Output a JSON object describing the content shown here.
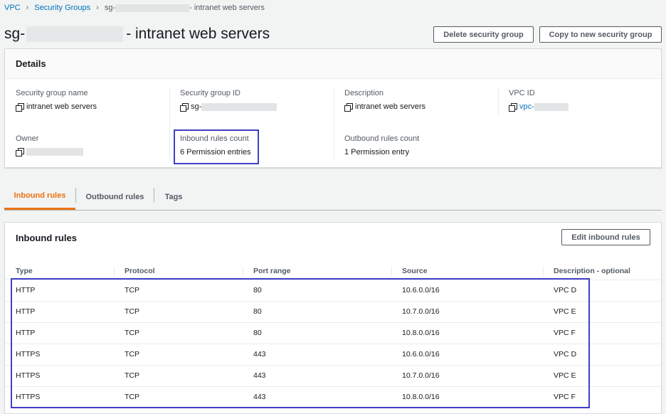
{
  "breadcrumb": {
    "vpc": "VPC",
    "security_groups": "Security Groups",
    "current_prefix": "sg-",
    "current_suffix": "- intranet web servers"
  },
  "title": {
    "prefix": "sg-",
    "suffix": "- intranet web servers"
  },
  "actions": {
    "delete": "Delete security group",
    "copy": "Copy to new security group"
  },
  "details": {
    "header": "Details",
    "security_group_name": {
      "label": "Security group name",
      "value": "intranet web servers"
    },
    "security_group_id": {
      "label": "Security group ID",
      "value": "sg-"
    },
    "description": {
      "label": "Description",
      "value": "intranet web servers"
    },
    "vpc_id": {
      "label": "VPC ID",
      "value": "vpc-"
    },
    "owner": {
      "label": "Owner",
      "value": ""
    },
    "inbound_count": {
      "label": "Inbound rules count",
      "value": "6 Permission entries"
    },
    "outbound_count": {
      "label": "Outbound rules count",
      "value": "1 Permission entry"
    }
  },
  "tabs": [
    {
      "label": "Inbound rules",
      "active": true
    },
    {
      "label": "Outbound rules",
      "active": false
    },
    {
      "label": "Tags",
      "active": false
    }
  ],
  "inbound": {
    "header": "Inbound rules",
    "edit_label": "Edit inbound rules",
    "columns": [
      "Type",
      "Protocol",
      "Port range",
      "Source",
      "Description - optional"
    ],
    "rows": [
      [
        "HTTP",
        "TCP",
        "80",
        "10.6.0.0/16",
        "VPC D"
      ],
      [
        "HTTP",
        "TCP",
        "80",
        "10.7.0.0/16",
        "VPC E"
      ],
      [
        "HTTP",
        "TCP",
        "80",
        "10.8.0.0/16",
        "VPC F"
      ],
      [
        "HTTPS",
        "TCP",
        "443",
        "10.6.0.0/16",
        "VPC D"
      ],
      [
        "HTTPS",
        "TCP",
        "443",
        "10.7.0.0/16",
        "VPC E"
      ],
      [
        "HTTPS",
        "TCP",
        "443",
        "10.8.0.0/16",
        "VPC F"
      ]
    ]
  },
  "colors": {
    "link": "#0073bb",
    "active_tab": "#ec7211",
    "highlight": "#3f3fc7"
  }
}
